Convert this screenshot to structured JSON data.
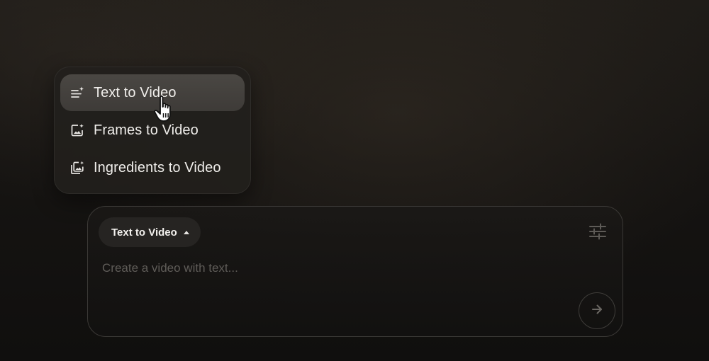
{
  "mode_menu": {
    "items": [
      {
        "label": "Text to Video",
        "icon": "text-sparkle-icon",
        "selected": true
      },
      {
        "label": "Frames to Video",
        "icon": "image-sparkle-icon",
        "selected": false
      },
      {
        "label": "Ingredients to Video",
        "icon": "images-stack-sparkle-icon",
        "selected": false
      }
    ]
  },
  "composer": {
    "mode_chip_label": "Text to Video",
    "prompt_value": "",
    "prompt_placeholder": "Create a video with text...",
    "settings_icon": "sliders-icon",
    "submit_icon": "arrow-right-icon"
  },
  "colors": {
    "menu_bg": "#221f1c",
    "active_item_bg": "#44413e",
    "text_primary": "#f0eeeb",
    "placeholder": "#5f5c58",
    "composer_border": "#3b3936"
  }
}
